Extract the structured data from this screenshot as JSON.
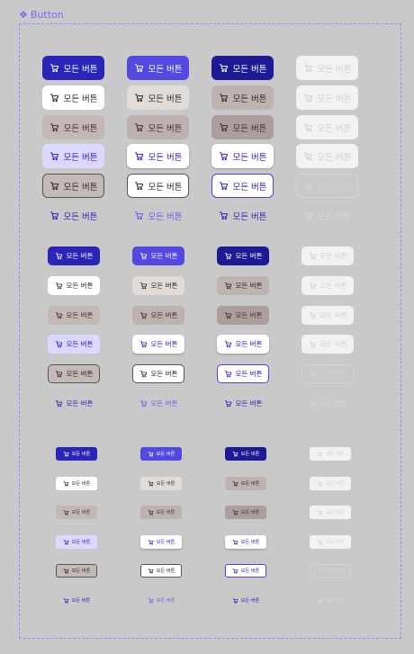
{
  "header": {
    "title": "Button",
    "icon": "component-diamond-icon",
    "color": "#8b5cf6"
  },
  "button_label": "모든 버튼",
  "button_icon": "cart-icon",
  "sizes": [
    "lg",
    "md",
    "sm"
  ],
  "variants": [
    "primary",
    "white",
    "muted",
    "tint",
    "outline",
    "text"
  ],
  "states": [
    "default",
    "hover",
    "active",
    "disabled"
  ],
  "colors": {
    "primary": "#2a24b8",
    "primary_hover": "#5348df",
    "primary_active": "#1e1a95",
    "tint": "#dcd8ff",
    "frame_border": "#9b84ff"
  }
}
